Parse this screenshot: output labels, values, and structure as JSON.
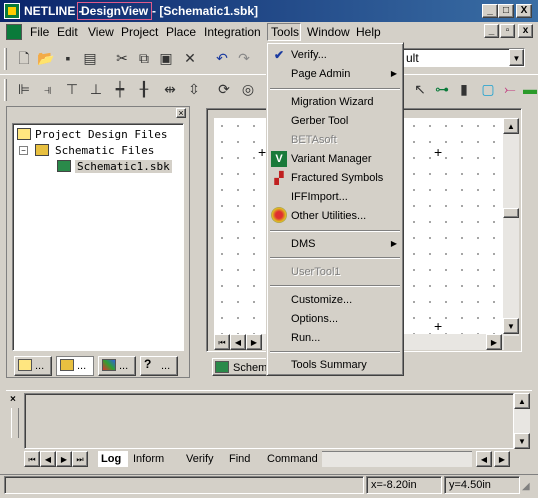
{
  "window": {
    "app_name": "NETLINE - ",
    "view_name": "DesignView",
    "document": "- [Schematic1.sbk]",
    "controls": [
      "_",
      "□",
      "X"
    ]
  },
  "menubar": {
    "items": [
      "File",
      "Edit",
      "View",
      "Project",
      "Place",
      "Integration",
      "Tools",
      "Window",
      "Help"
    ],
    "mdi_controls": [
      "_",
      "▫",
      "x"
    ]
  },
  "toolbar": {
    "dropdown_value": "ult"
  },
  "project_panel": {
    "tree": {
      "root": "Project Design Files",
      "folder": "Schematic Files",
      "file": "Schematic1.sbk"
    },
    "tabs": [
      "...",
      "...",
      "...",
      "..."
    ]
  },
  "canvas": {
    "sheet_tab": "Schem"
  },
  "tools_menu": {
    "items": [
      {
        "label": "Verify...",
        "icon": "verify-checkmark-icon",
        "enabled": true
      },
      {
        "label": "Page Admin",
        "submenu": true,
        "enabled": true
      },
      {
        "label": "Migration Wizard",
        "enabled": true
      },
      {
        "label": "Gerber Tool",
        "enabled": true
      },
      {
        "label": "BETAsoft",
        "enabled": false
      },
      {
        "label": "Variant Manager",
        "icon": "variant-v-icon",
        "enabled": true
      },
      {
        "label": "Fractured Symbols",
        "icon": "fractured-symbols-icon",
        "enabled": true
      },
      {
        "label": "IFFImport...",
        "enabled": true
      },
      {
        "label": "Other Utilities...",
        "icon": "utilities-icon",
        "enabled": true
      },
      {
        "label": "DMS",
        "submenu": true,
        "enabled": true
      },
      {
        "label": "UserTool1",
        "enabled": false
      },
      {
        "label": "Customize...",
        "enabled": true
      },
      {
        "label": "Options...",
        "enabled": true
      },
      {
        "label": "Run...",
        "enabled": true
      },
      {
        "label": "Tools Summary",
        "enabled": true
      }
    ]
  },
  "log_panel": {
    "tabs": [
      "Log",
      "Inform",
      "Verify",
      "Find",
      "Command"
    ],
    "active_tab": "Log"
  },
  "statusbar": {
    "x": "x=-8.20in",
    "y": "y=4.50in"
  }
}
